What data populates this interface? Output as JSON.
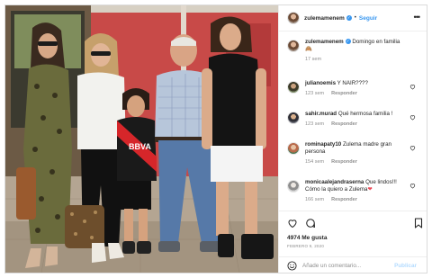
{
  "post": {
    "username": "zulemamenem",
    "follow_label": "Seguir",
    "more_icon": "more-horizontal-icon"
  },
  "caption": {
    "username": "zulemamenem",
    "text": "Domingo en familia",
    "emoji": "🙈",
    "time": "17 sem"
  },
  "comments": [
    {
      "username": "julianoemis",
      "text": "Y NAIR????",
      "time": "123 sem",
      "reply": "Responder"
    },
    {
      "username": "sahir.murad",
      "text": "Qué hermosa familia !",
      "time": "123 sem",
      "reply": "Responder"
    },
    {
      "username": "rominapaty10",
      "text": "Zulema madre gran persona",
      "time": "154 sem",
      "reply": "Responder"
    },
    {
      "username": "monicaalejandraserna",
      "text": "Que lindos!!! Cómo la quiero a Zulema",
      "emoji": "❤",
      "time": "166 sem",
      "reply": "Responder"
    }
  ],
  "actions": {
    "likes": "4974 Me gusta",
    "date": "Febrero 9, 2020"
  },
  "comment_box": {
    "placeholder": "Añade un comentario...",
    "post_label": "Publicar"
  },
  "colors": {
    "accent": "#3897f0",
    "muted": "#8e8e8e",
    "border": "#efefef"
  }
}
